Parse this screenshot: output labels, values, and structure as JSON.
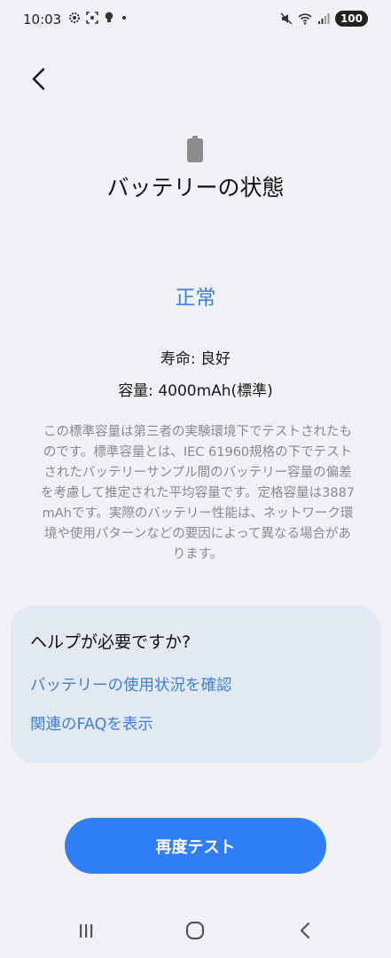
{
  "status_bar": {
    "time": "10:03",
    "battery_level": "100"
  },
  "header": {
    "title": "バッテリーの状態"
  },
  "main": {
    "status": "正常",
    "life": "寿命: 良好",
    "capacity": "容量: 4000mAh(標準)",
    "description": "この標準容量は第三者の実験環境下でテストされたものです。標準容量とは、IEC 61960規格の下でテストされたバッテリーサンプル間のバッテリー容量の偏差を考慮して推定された平均容量です。定格容量は3887mAhです。実際のバッテリー性能は、ネットワーク環境や使用パターンなどの要因によって異なる場合があります。"
  },
  "help": {
    "title": "ヘルプが必要ですか?",
    "links": [
      "バッテリーの使用状況を確認",
      "関連のFAQを表示"
    ]
  },
  "actions": {
    "retest_label": "再度テスト"
  },
  "colors": {
    "accent": "#3d7ee0",
    "button": "#2f7ef5",
    "background": "#f1f1f5",
    "card": "#e3e9f3"
  },
  "icons": {
    "back": "chevron-left-icon",
    "battery": "battery-icon",
    "nav_recent": "recent-apps-icon",
    "nav_home": "home-icon",
    "nav_back": "back-icon"
  }
}
